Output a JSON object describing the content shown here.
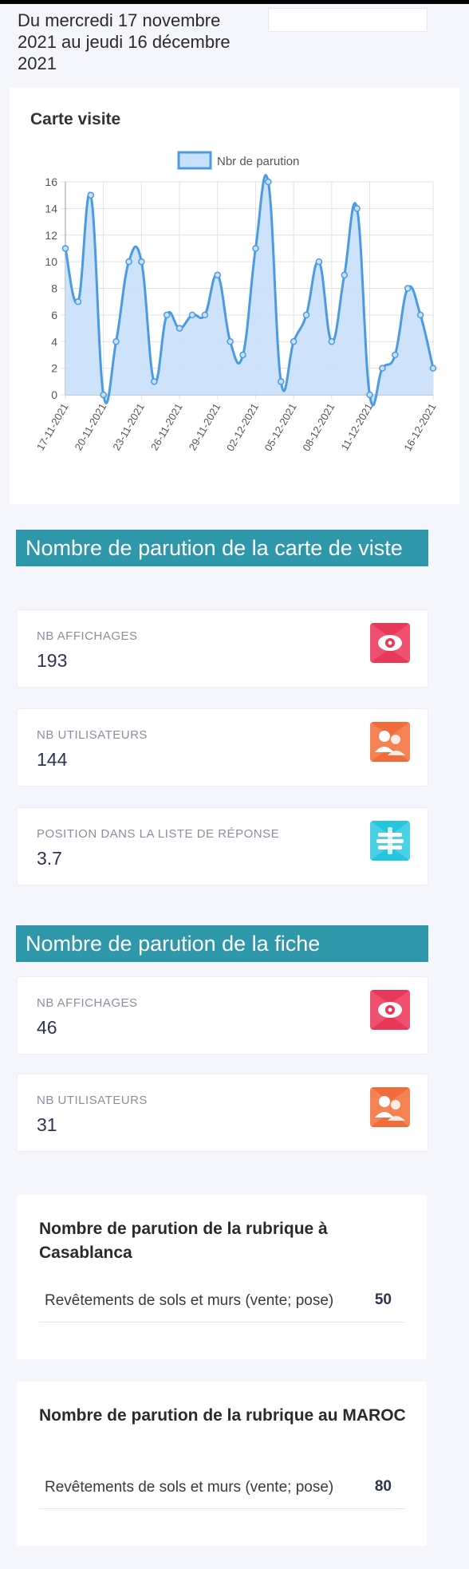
{
  "header": {
    "date_range": "Du mercredi 17 novembre 2021 au jeudi 16 décembre 2021"
  },
  "chart_card": {
    "title": "Carte visite"
  },
  "chart_data": {
    "type": "line",
    "legend": [
      "Nbr de parution"
    ],
    "legend_position": "top",
    "x": [
      "17-11-2021",
      "18-11-2021",
      "19-11-2021",
      "20-11-2021",
      "21-11-2021",
      "22-11-2021",
      "23-11-2021",
      "24-11-2021",
      "25-11-2021",
      "26-11-2021",
      "27-11-2021",
      "28-11-2021",
      "29-11-2021",
      "30-11-2021",
      "01-12-2021",
      "02-12-2021",
      "03-12-2021",
      "04-12-2021",
      "05-12-2021",
      "06-12-2021",
      "07-12-2021",
      "08-12-2021",
      "09-12-2021",
      "10-12-2021",
      "11-12-2021",
      "12-12-2021",
      "13-12-2021",
      "14-12-2021",
      "15-12-2021",
      "16-12-2021"
    ],
    "tick_labels": [
      "17-11-2021",
      "20-11-2021",
      "23-11-2021",
      "26-11-2021",
      "29-11-2021",
      "02-12-2021",
      "05-12-2021",
      "08-12-2021",
      "11-12-2021",
      "16-12-2021"
    ],
    "series": [
      {
        "name": "Nbr de parution",
        "values": [
          11,
          7,
          15,
          0,
          4,
          10,
          10,
          1,
          6,
          5,
          6,
          6,
          9,
          4,
          3,
          11,
          16,
          1,
          4,
          6,
          10,
          4,
          9,
          14,
          0,
          2,
          3,
          8,
          6,
          2
        ]
      }
    ],
    "ylim": [
      0,
      16
    ],
    "yticks": [
      0,
      2,
      4,
      6,
      8,
      10,
      12,
      14,
      16
    ],
    "grid": true,
    "colors": {
      "line": "#4a9be3",
      "fill": "#c9e0fb",
      "grid": "#e2e2e2"
    }
  },
  "section_carte": {
    "title": "Nombre de parution de la carte de viste",
    "stats": [
      {
        "label": "NB AFFICHAGES",
        "value": "193",
        "icon": "eye-icon",
        "color": "#e8385a"
      },
      {
        "label": "NB UTILISATEURS",
        "value": "144",
        "icon": "users-icon",
        "color": "#f06c3a"
      },
      {
        "label": "POSITION DANS LA LISTE DE RÉPONSE",
        "value": "3.7",
        "icon": "list-position-icon",
        "color": "#25c5de"
      }
    ]
  },
  "section_fiche": {
    "title": "Nombre de parution de la fiche",
    "stats": [
      {
        "label": "NB AFFICHAGES",
        "value": "46",
        "icon": "eye-icon",
        "color": "#e8385a"
      },
      {
        "label": "NB UTILISATEURS",
        "value": "31",
        "icon": "users-icon",
        "color": "#f06c3a"
      }
    ]
  },
  "rubrique_casablanca": {
    "title": "Nombre de parution de la rubrique à Casablanca",
    "rows": [
      {
        "name": "Revêtements de sols et murs (vente; pose)",
        "value": "50"
      }
    ]
  },
  "rubrique_maroc": {
    "title": "Nombre de parution de la rubrique au MAROC",
    "rows": [
      {
        "name": "Revêtements de sols et murs (vente; pose)",
        "value": "80"
      }
    ]
  }
}
